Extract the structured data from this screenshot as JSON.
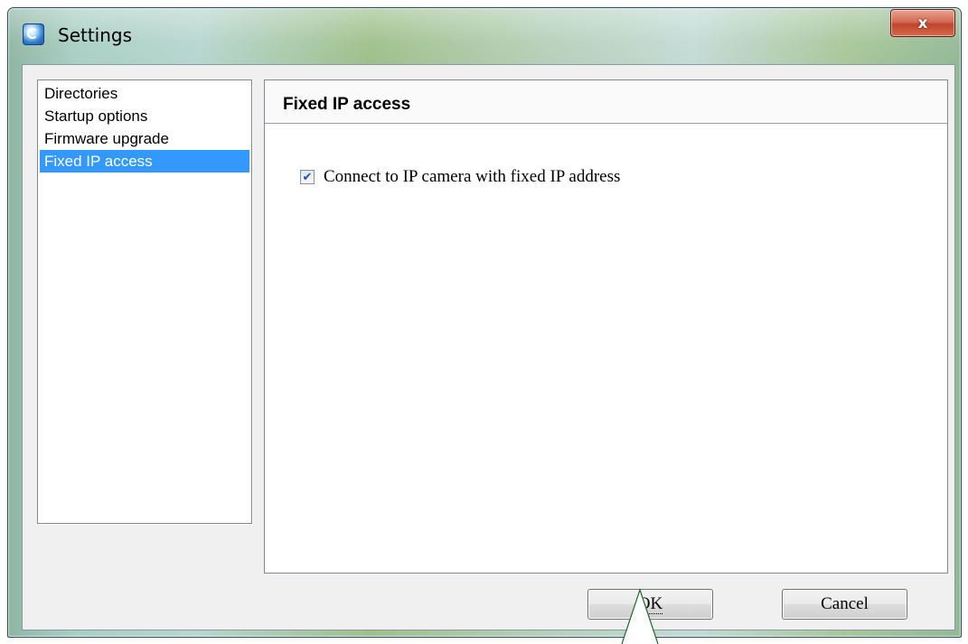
{
  "window": {
    "title": "Settings",
    "close_label": "x"
  },
  "nav": {
    "items": [
      {
        "label": "Directories",
        "selected": false
      },
      {
        "label": "Startup options",
        "selected": false
      },
      {
        "label": "Firmware upgrade",
        "selected": false
      },
      {
        "label": "Fixed IP access",
        "selected": true
      }
    ]
  },
  "panel": {
    "title": "Fixed IP access",
    "checkbox": {
      "label": "Connect to IP camera with fixed IP address",
      "checked": true
    }
  },
  "buttons": {
    "ok_label": "OK",
    "cancel_label": "Cancel"
  },
  "colors": {
    "selection": "#3399ff",
    "close_button": "#c0452d",
    "callout_stroke": "#1a6b2a"
  }
}
